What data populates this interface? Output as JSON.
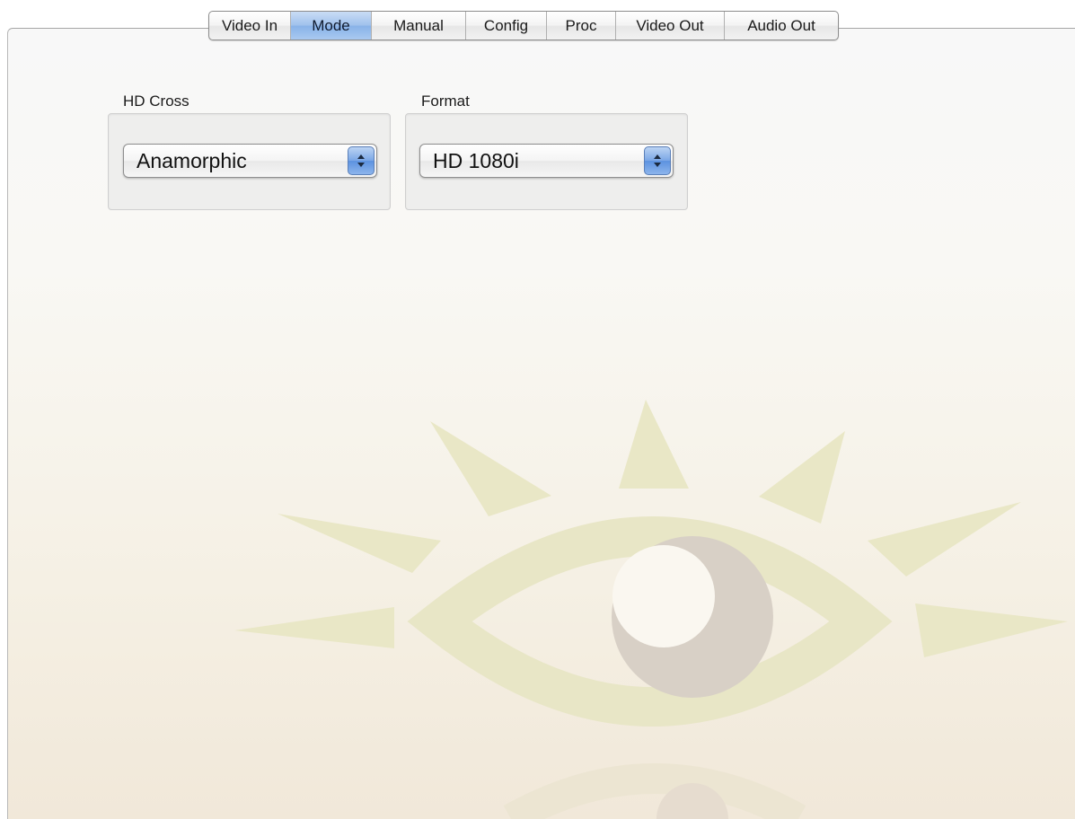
{
  "tabs": [
    {
      "label": "Video In",
      "selected": false
    },
    {
      "label": "Mode",
      "selected": true
    },
    {
      "label": "Manual",
      "selected": false
    },
    {
      "label": "Config",
      "selected": false
    },
    {
      "label": "Proc",
      "selected": false
    },
    {
      "label": "Video Out",
      "selected": false
    },
    {
      "label": "Audio Out",
      "selected": false
    }
  ],
  "hd_cross": {
    "label": "HD Cross",
    "value": "Anamorphic"
  },
  "format": {
    "label": "Format",
    "value": "HD 1080i"
  },
  "watermark": {
    "icon": "eye-logo-icon"
  },
  "colors": {
    "selected_tab": "#9fc1ec",
    "watermark_ray": "#e8e6c4",
    "watermark_iris": "#d6cfc4"
  }
}
